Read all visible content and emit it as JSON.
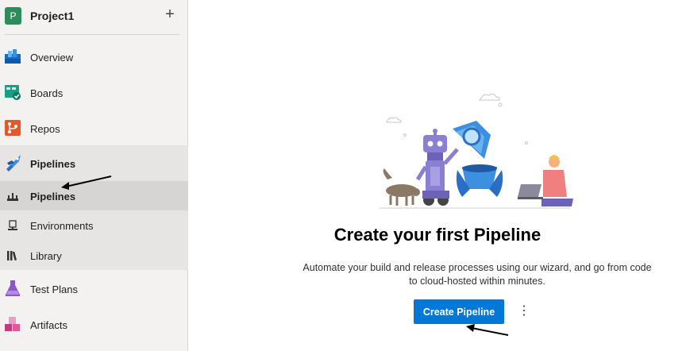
{
  "project": {
    "avatar_letter": "P",
    "name": "Project1",
    "add_icon": "plus-icon",
    "avatar_color": "#2f8c5a"
  },
  "nav": {
    "overview": "Overview",
    "boards": "Boards",
    "repos": "Repos",
    "pipelines": "Pipelines",
    "pipelines_sub": {
      "pipelines": "Pipelines",
      "environments": "Environments",
      "library": "Library"
    },
    "test_plans": "Test Plans",
    "artifacts": "Artifacts"
  },
  "main": {
    "headline": "Create your first Pipeline",
    "description": "Automate your build and release processes using our wizard, and go from code to cloud-hosted within minutes.",
    "create_button": "Create Pipeline",
    "more_icon": "more-vertical-icon"
  },
  "colors": {
    "accent": "#0078d4",
    "sidebar_bg": "#f3f2f1",
    "selected_bg": "#d6d5d4"
  }
}
